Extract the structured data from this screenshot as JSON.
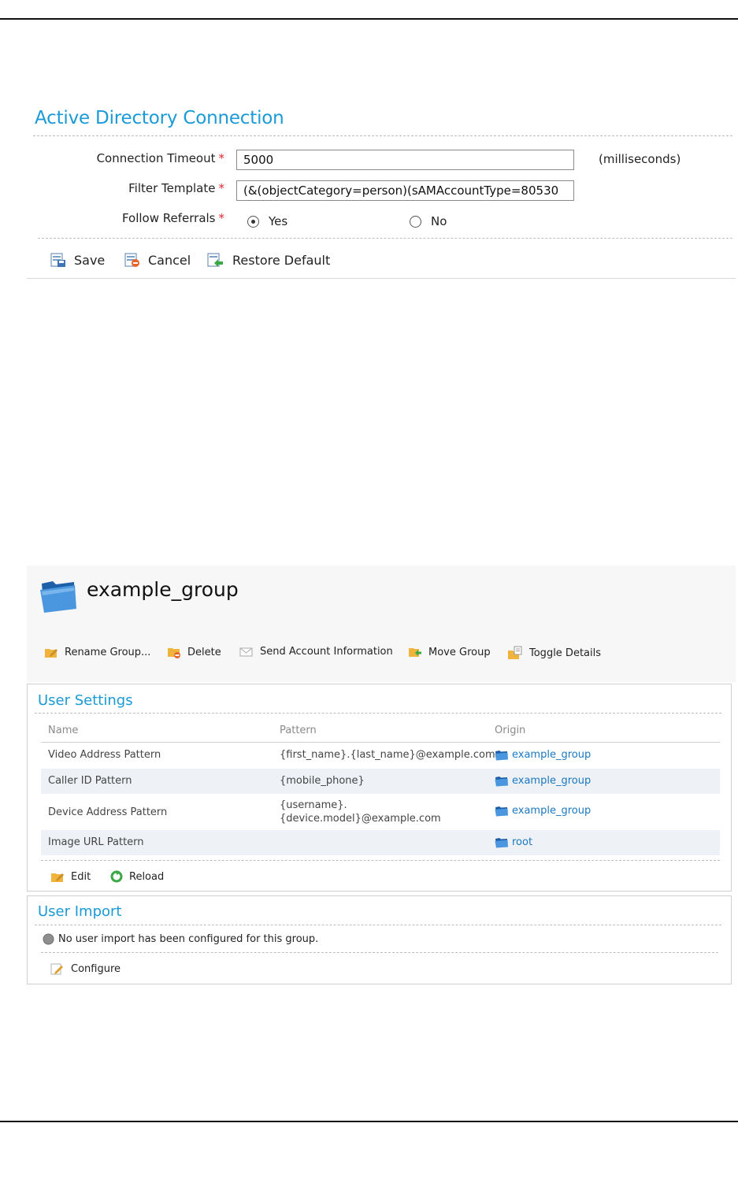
{
  "ad_connection": {
    "title": "Active Directory Connection",
    "required_mark": "*",
    "fields": {
      "connection_timeout": {
        "label": "Connection Timeout",
        "value": "5000",
        "unit": "(milliseconds)"
      },
      "filter_template": {
        "label": "Filter Template",
        "value": "(&(objectCategory=person)(sAMAccountType=80530"
      },
      "follow_referrals": {
        "label": "Follow Referrals",
        "options": [
          "Yes",
          "No"
        ],
        "selected": "Yes"
      }
    },
    "toolbar": {
      "save": "Save",
      "cancel": "Cancel",
      "restore": "Restore Default"
    }
  },
  "group": {
    "name": "example_group",
    "toolbar": {
      "rename": "Rename Group...",
      "delete": "Delete",
      "send": "Send Account Information",
      "move": "Move Group",
      "toggle": "Toggle Details"
    },
    "user_settings": {
      "title": "User Settings",
      "columns": [
        "Name",
        "Pattern",
        "Origin"
      ],
      "rows": [
        {
          "name": "Video Address Pattern",
          "pattern": "{first_name}.{last_name}@example.com",
          "origin": "example_group"
        },
        {
          "name": "Caller ID Pattern",
          "pattern": "{mobile_phone}",
          "origin": "example_group"
        },
        {
          "name": "Device Address Pattern",
          "pattern_line1": "{username}.",
          "pattern_line2": "{device.model}@example.com",
          "origin": "example_group"
        },
        {
          "name": "Image URL Pattern",
          "pattern": "",
          "origin": "root"
        }
      ],
      "edit": "Edit",
      "reload": "Reload"
    },
    "user_import": {
      "title": "User Import",
      "status": "No user import has been configured for this group.",
      "configure": "Configure"
    }
  },
  "colors": {
    "accent": "#1a9ad6",
    "link": "#1a78c2",
    "required": "#e3262b",
    "row_alt": "#eef1f5"
  }
}
